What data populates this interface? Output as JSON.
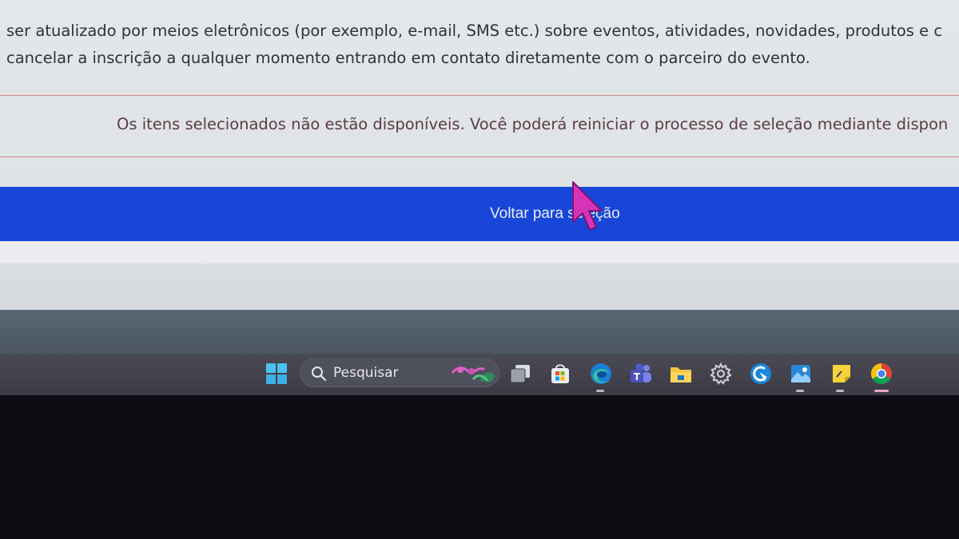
{
  "page": {
    "consent_line_1": "ser atualizado por meios eletrônicos (por exemplo, e-mail, SMS etc.) sobre eventos, atividades, novidades, produtos e c",
    "consent_line_2": "cancelar a inscrição a qualquer momento entrando em contato diretamente com o parceiro do evento.",
    "notice": "Os itens selecionados não estão disponíveis. Você poderá reiniciar o processo de seleção mediante dispon",
    "back_button_label": "Voltar para seleção"
  },
  "taskbar": {
    "search_placeholder": "Pesquisar",
    "icons": [
      "windows-start-icon",
      "search-icon",
      "task-view-icon",
      "microsoft-store-icon",
      "edge-icon",
      "teams-icon",
      "file-explorer-icon",
      "settings-icon",
      "quick-assist-icon",
      "photos-icon",
      "sticky-notes-icon",
      "chrome-icon"
    ]
  },
  "colors": {
    "primary_button": "#1846d8",
    "notice_text": "#5a3c44",
    "divider": "#c98d8d",
    "cursor": "#d633b8"
  }
}
